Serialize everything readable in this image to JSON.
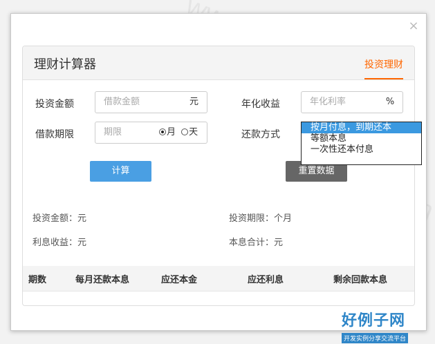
{
  "watermark": "www.haolizi.com",
  "dialog": {
    "close_glyph": "×"
  },
  "panel": {
    "title": "理财计算器",
    "tab": "投资理财"
  },
  "form": {
    "invest_amount_label": "投资金额",
    "invest_amount_placeholder": "借款金额",
    "invest_amount_unit": "元",
    "annual_yield_label": "年化收益",
    "annual_yield_placeholder": "年化利率",
    "annual_yield_unit": "%",
    "period_label": "借款期限",
    "period_placeholder": "期限",
    "period_month": "月",
    "period_day": "天",
    "repay_label": "还款方式",
    "repay_options": [
      "按月付息，到期还本",
      "等额本息",
      "一次性还本付息"
    ]
  },
  "buttons": {
    "calculate": "计算",
    "reset": "重置数据"
  },
  "results": {
    "invest_amount": "投资金额：元",
    "invest_period": "投资期限：个月",
    "interest": "利息收益：元",
    "total": "本息合计：元"
  },
  "table": {
    "headers": [
      "期数",
      "每月还款本息",
      "应还本金",
      "应还利息",
      "剩余回款本息"
    ]
  },
  "logo": {
    "main": "好例子网",
    "sub": "开发实例分享交流平台"
  },
  "colors": {
    "accent": "#ff6600",
    "calc_button": "#4a9fe3",
    "reset_button": "#666666",
    "selected_option": "#3b99e0"
  }
}
